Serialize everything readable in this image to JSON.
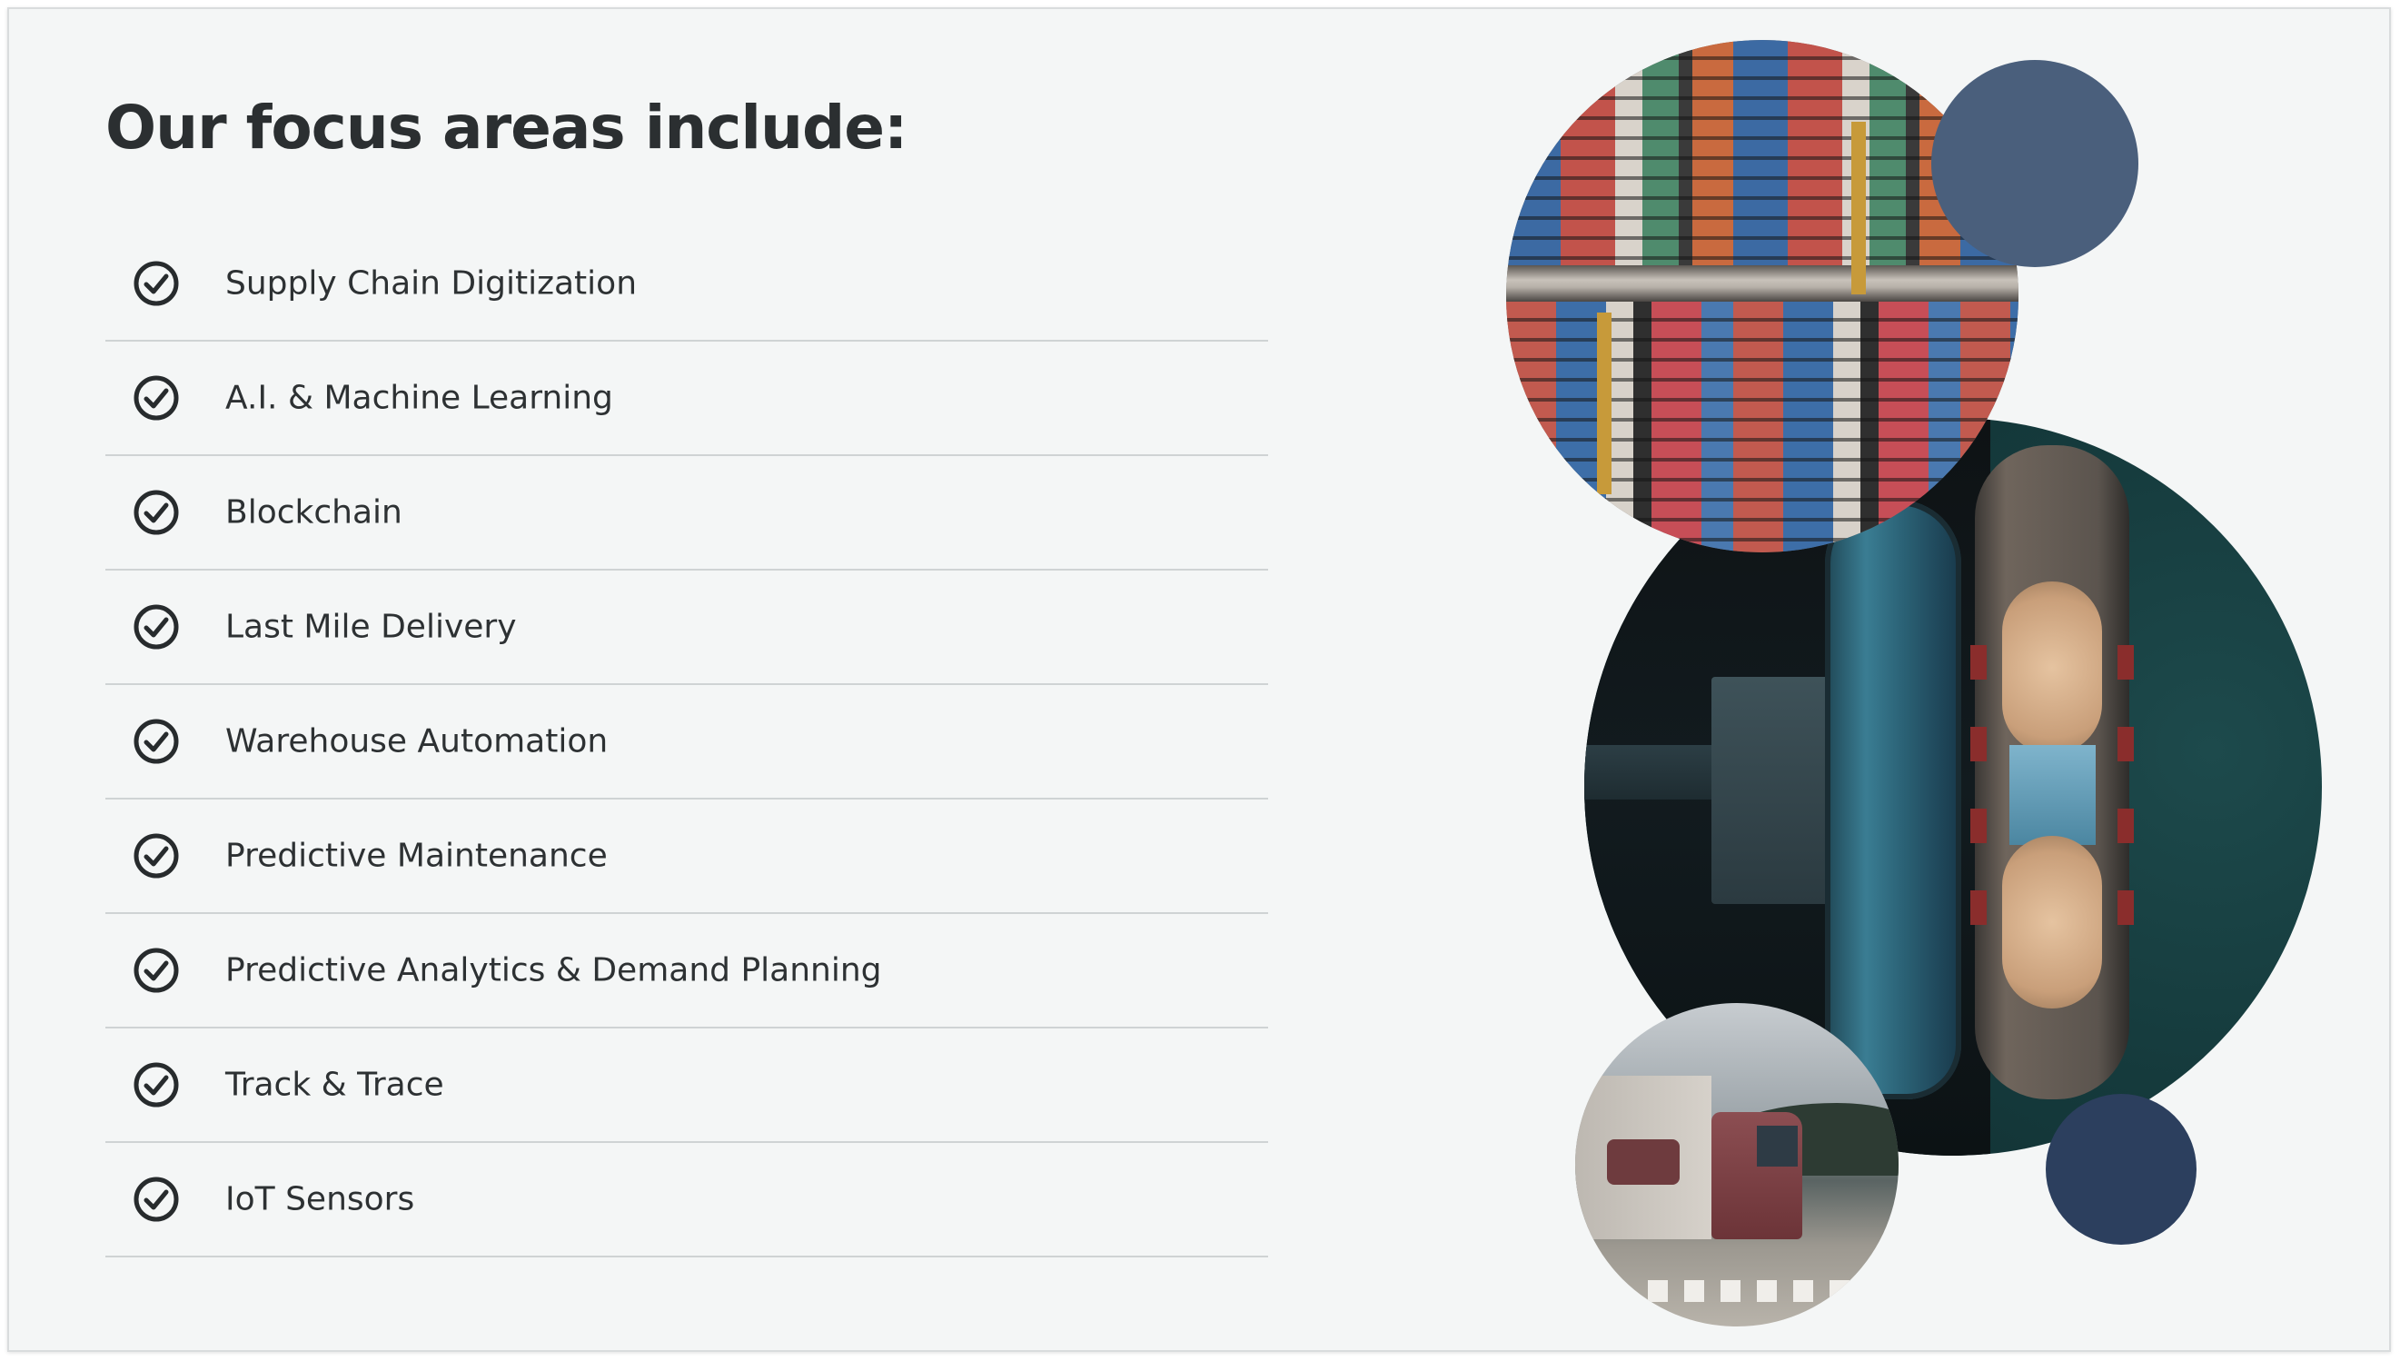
{
  "heading": "Our focus areas include:",
  "icons": {
    "item_icon": "check-circle-icon"
  },
  "colors": {
    "background": "#f4f6f6",
    "text": "#2b2f31",
    "divider": "#cfd3d4",
    "dot_light": "#4a5f7c",
    "dot_dark": "#2c3f5e"
  },
  "focus_items": [
    {
      "label": "Supply Chain Digitization"
    },
    {
      "label": "A.I. & Machine Learning"
    },
    {
      "label": "Blockchain"
    },
    {
      "label": "Last Mile Delivery"
    },
    {
      "label": "Warehouse Automation"
    },
    {
      "label": "Predictive Maintenance"
    },
    {
      "label": "Predictive Analytics & Demand Planning"
    },
    {
      "label": "Track & Trace"
    },
    {
      "label": "IoT Sensors"
    }
  ]
}
